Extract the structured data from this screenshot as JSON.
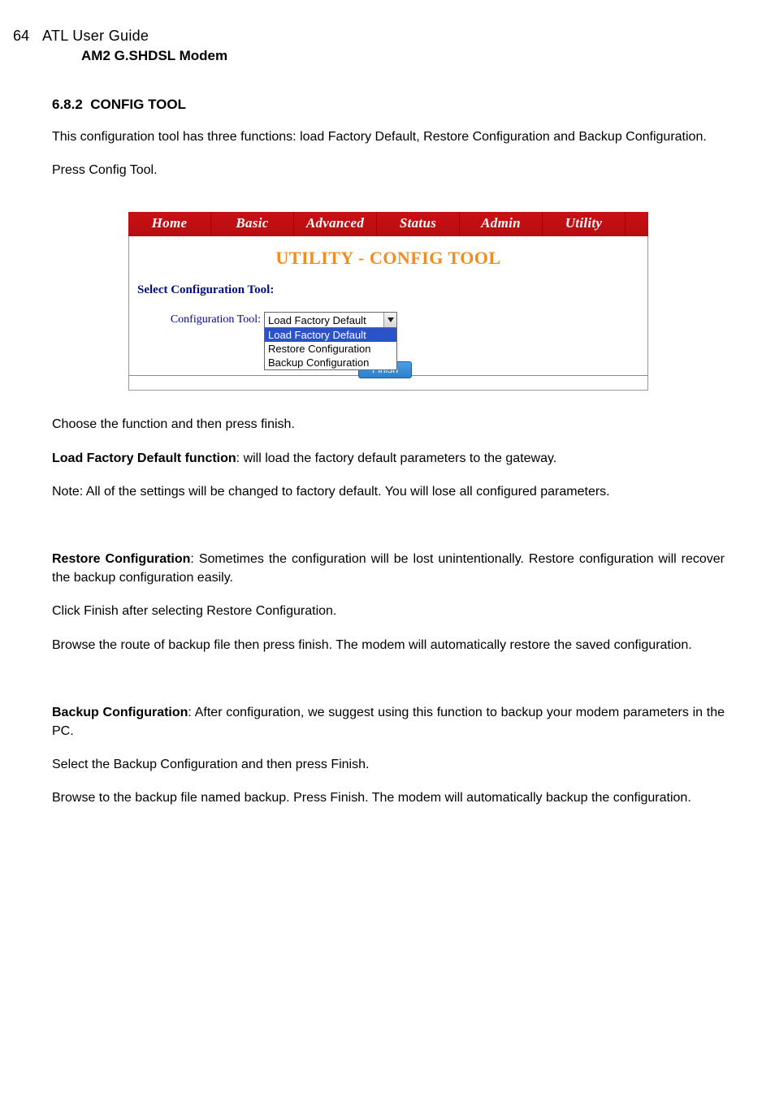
{
  "header": {
    "page_number": "64",
    "doc_title": "ATL User Guide",
    "product": "AM2 G.SHDSL Modem"
  },
  "section": {
    "number": "6.8.2",
    "title": "CONFIG TOOL"
  },
  "intro_para": "This configuration tool has three functions: load Factory Default, Restore Configuration and Backup Configuration.",
  "press_line": "Press Config Tool.",
  "ui": {
    "nav": [
      "Home",
      "Basic",
      "Advanced",
      "Status",
      "Admin",
      "Utility"
    ],
    "page_title": "UTILITY - CONFIG TOOL",
    "section_label": "Select Configuration Tool:",
    "field_label": "Configuration Tool:",
    "selected": "Load Factory Default",
    "options": [
      "Load Factory Default",
      "Restore Configuration",
      "Backup Configuration"
    ],
    "finish": "Finish"
  },
  "para_choose": "Choose the function and then press finish.",
  "load": {
    "label": "Load Factory Default function",
    "text": ": will load the factory default parameters to the gateway."
  },
  "note_line": "Note: All of the settings will be changed to factory default. You will lose all configured parameters.",
  "restore": {
    "label": "Restore Configuration",
    "text": ": Sometimes the configuration will be lost unintentionally. Restore configuration will recover the backup configuration easily."
  },
  "restore_click": "Click Finish after selecting Restore Configuration.",
  "restore_browse": "Browse the route of backup file then press finish. The modem will automatically restore the saved configuration.",
  "backup": {
    "label": "Backup Configuration",
    "text": ": After configuration, we suggest using this function to backup your modem parameters in the PC."
  },
  "backup_select": "Select the Backup Configuration and then press Finish.",
  "backup_browse": "Browse to the backup file named backup. Press Finish. The modem will automatically backup the configuration."
}
